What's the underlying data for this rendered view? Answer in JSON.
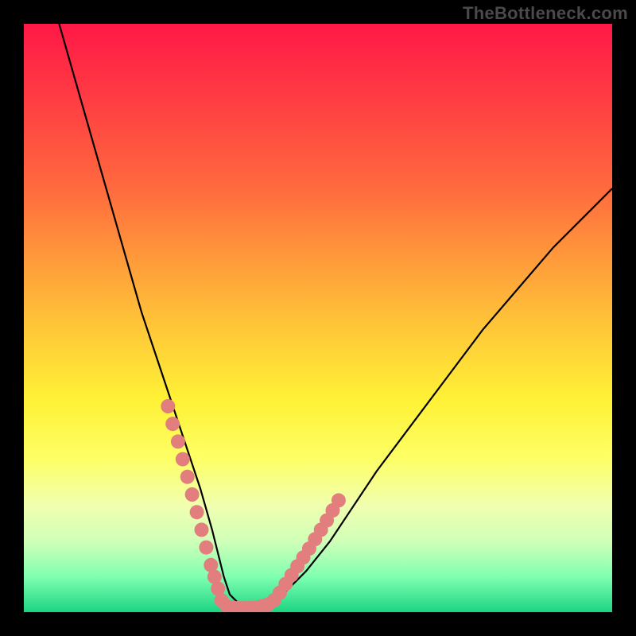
{
  "watermark": "TheBottleneck.com",
  "chart_data": {
    "type": "line",
    "title": "",
    "xlabel": "",
    "ylabel": "",
    "xlim": [
      0,
      100
    ],
    "ylim": [
      0,
      100
    ],
    "grid": false,
    "legend": false,
    "series": [
      {
        "name": "bottleneck-curve",
        "color": "#000000",
        "x": [
          6,
          8,
          10,
          12,
          14,
          16,
          18,
          20,
          22,
          24,
          26,
          28,
          30,
          32,
          33,
          34,
          35,
          37,
          40,
          44,
          48,
          52,
          56,
          60,
          66,
          72,
          78,
          84,
          90,
          96,
          100
        ],
        "y": [
          100,
          93,
          86,
          79,
          72,
          65,
          58,
          51,
          45,
          39,
          33,
          27,
          21,
          14,
          10,
          6,
          3,
          1,
          1,
          3,
          7,
          12,
          18,
          24,
          32,
          40,
          48,
          55,
          62,
          68,
          72
        ]
      },
      {
        "name": "highlight-dots-left",
        "color": "#e37e7e",
        "type": "scatter",
        "x": [
          24.5,
          25.3,
          26.2,
          27.0,
          27.8,
          28.6,
          29.4,
          30.2,
          31.0,
          31.8,
          32.4,
          33.0,
          33.6
        ],
        "y": [
          35,
          32,
          29,
          26,
          23,
          20,
          17,
          14,
          11,
          8,
          6,
          4,
          2
        ]
      },
      {
        "name": "highlight-dots-bottom",
        "color": "#e37e7e",
        "type": "scatter",
        "x": [
          34.5,
          35.5,
          36.5,
          37.5,
          38.5,
          39.5,
          40.5,
          41.5
        ],
        "y": [
          1,
          0.8,
          0.7,
          0.7,
          0.7,
          0.8,
          1.0,
          1.3
        ]
      },
      {
        "name": "highlight-dots-right",
        "color": "#e37e7e",
        "type": "scatter",
        "x": [
          42.5,
          43.5,
          44.5,
          45.5,
          46.5,
          47.5,
          48.5,
          49.5,
          50.5,
          51.5,
          52.5,
          53.5
        ],
        "y": [
          2,
          3.3,
          4.8,
          6.3,
          7.8,
          9.3,
          10.8,
          12.4,
          14,
          15.6,
          17.3,
          19
        ]
      }
    ],
    "gradient_stops": [
      {
        "pos": 0.0,
        "color": "#ff1846"
      },
      {
        "pos": 0.12,
        "color": "#ff3a43"
      },
      {
        "pos": 0.28,
        "color": "#ff6a3e"
      },
      {
        "pos": 0.4,
        "color": "#ff9a3a"
      },
      {
        "pos": 0.52,
        "color": "#ffc838"
      },
      {
        "pos": 0.64,
        "color": "#fff236"
      },
      {
        "pos": 0.74,
        "color": "#fdff66"
      },
      {
        "pos": 0.82,
        "color": "#f0ffb0"
      },
      {
        "pos": 0.88,
        "color": "#d0ffb8"
      },
      {
        "pos": 0.94,
        "color": "#7fffb0"
      },
      {
        "pos": 1.0,
        "color": "#1cd483"
      }
    ]
  }
}
